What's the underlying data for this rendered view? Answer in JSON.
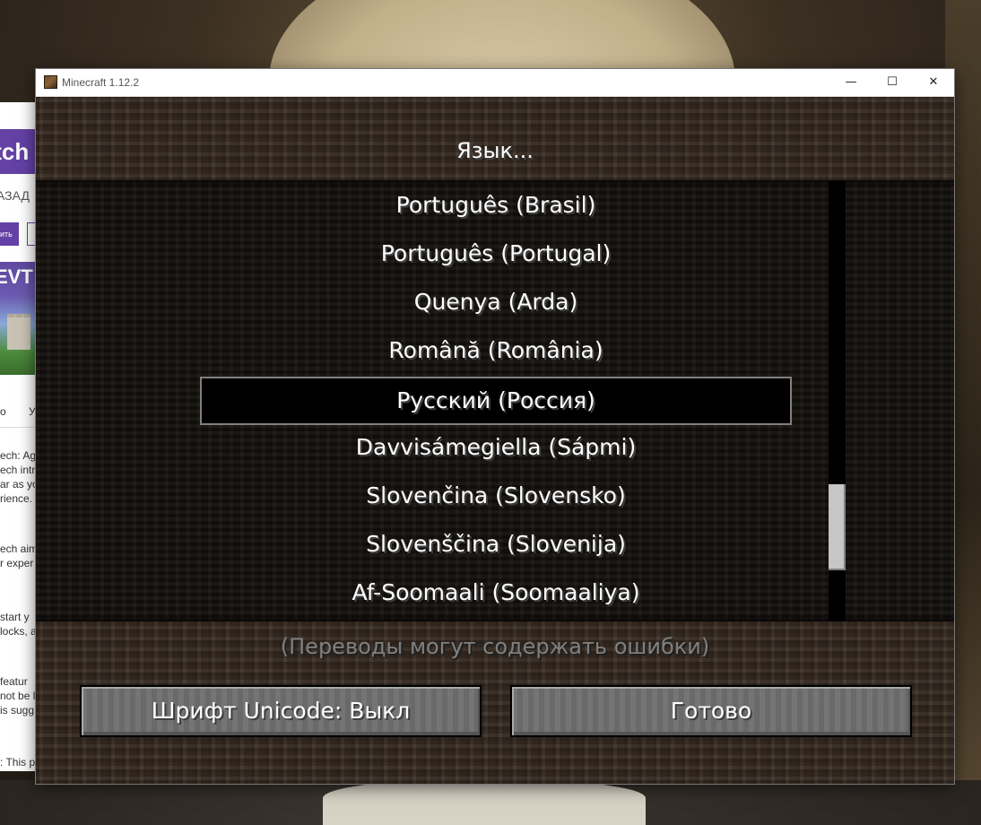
{
  "window": {
    "title": "Minecraft 1.12.2",
    "min_glyph": "—",
    "max_glyph": "☐",
    "close_glyph": "✕"
  },
  "screen": {
    "title": "Язык...",
    "languages": [
      "Português (Brasil)",
      "Português (Portugal)",
      "Quenya (Arda)",
      "Română (România)",
      "Русский (Россия)",
      "Davvisámegiella (Sápmi)",
      "Slovenčina (Slovensko)",
      "Slovenščina (Slovenija)",
      "Af-Soomaali (Soomaaliya)"
    ],
    "selected_language": "Русский (Россия)",
    "note": "(Переводы могут содержать ошибки)",
    "unicode_button": "Шрифт Unicode: Выкл",
    "done_button": "Готово"
  },
  "background_browser": {
    "logo": "itch",
    "back": "АЗАД",
    "button": "ить",
    "banner": "EVT",
    "tab1": "о",
    "tab2": "У",
    "p1": "ech: Age\nech intr\nar as yo\nrience.",
    "p2": "ech aim\nr exper",
    "p3": "start y\nlocks, a",
    "p4": "featur\nnot be l\nis sugg",
    "p5": ": This p"
  }
}
